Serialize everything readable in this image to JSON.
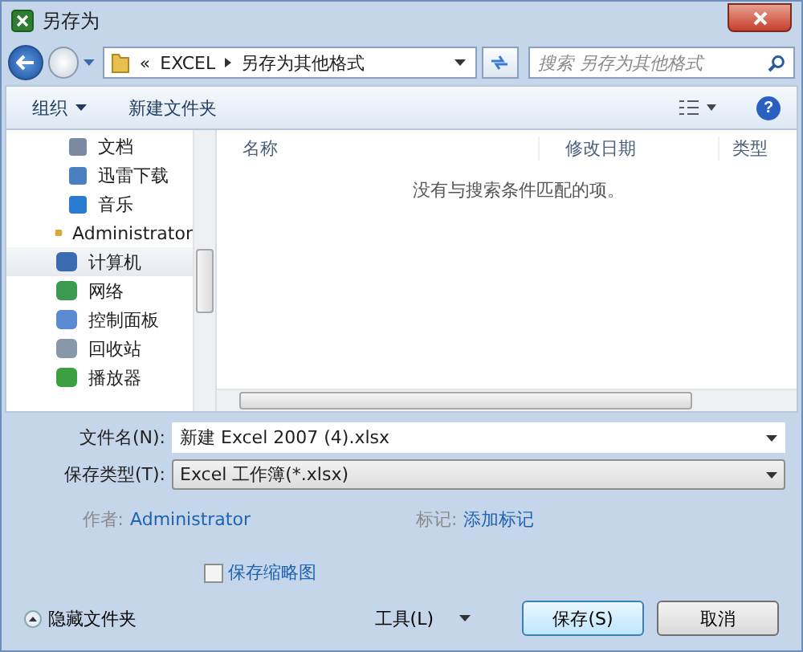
{
  "window": {
    "title": "另存为"
  },
  "address": {
    "crumbs": [
      "«",
      "EXCEL",
      "另存为其他格式"
    ]
  },
  "search": {
    "placeholder": "搜索 另存为其他格式"
  },
  "toolbar": {
    "help": "?",
    "buttons": [
      {
        "label": "组织",
        "dropdown": true
      },
      {
        "label": "新建文件夹",
        "dropdown": false
      }
    ]
  },
  "sidebar": {
    "library_items": [
      {
        "label": "文档",
        "kind": "document",
        "selected": false
      },
      {
        "label": "迅雷下载",
        "kind": "download",
        "selected": false
      },
      {
        "label": "音乐",
        "kind": "music",
        "selected": false
      }
    ],
    "items": [
      {
        "label": "Administrator",
        "kind": "user",
        "selected": false
      },
      {
        "label": "计算机",
        "kind": "computer",
        "selected": true
      },
      {
        "label": "网络",
        "kind": "network",
        "selected": false
      },
      {
        "label": "控制面板",
        "kind": "panel",
        "selected": false
      },
      {
        "label": "回收站",
        "kind": "recycle",
        "selected": false
      },
      {
        "label": "播放器",
        "kind": "player",
        "selected": false
      }
    ]
  },
  "file_list": {
    "columns": [
      "名称",
      "修改日期",
      "类型"
    ],
    "empty_message": "没有与搜索条件匹配的项。"
  },
  "form": {
    "file_name_label": "文件名(N):",
    "file_name": "新建 Excel 2007 (4).xlsx",
    "type_label": "保存类型(T):",
    "type": "Excel 工作簿(*.xlsx)",
    "author_label": "作者:",
    "author": "Administrator",
    "tags_label": "标记:",
    "tags": "添加标记",
    "thumbnail": {
      "label": "保存缩略图",
      "checked": false
    }
  },
  "footer": {
    "hide_folders": "隐藏文件夹",
    "tools": "工具(L)",
    "buttons": [
      "保存(S)",
      "取消"
    ]
  }
}
